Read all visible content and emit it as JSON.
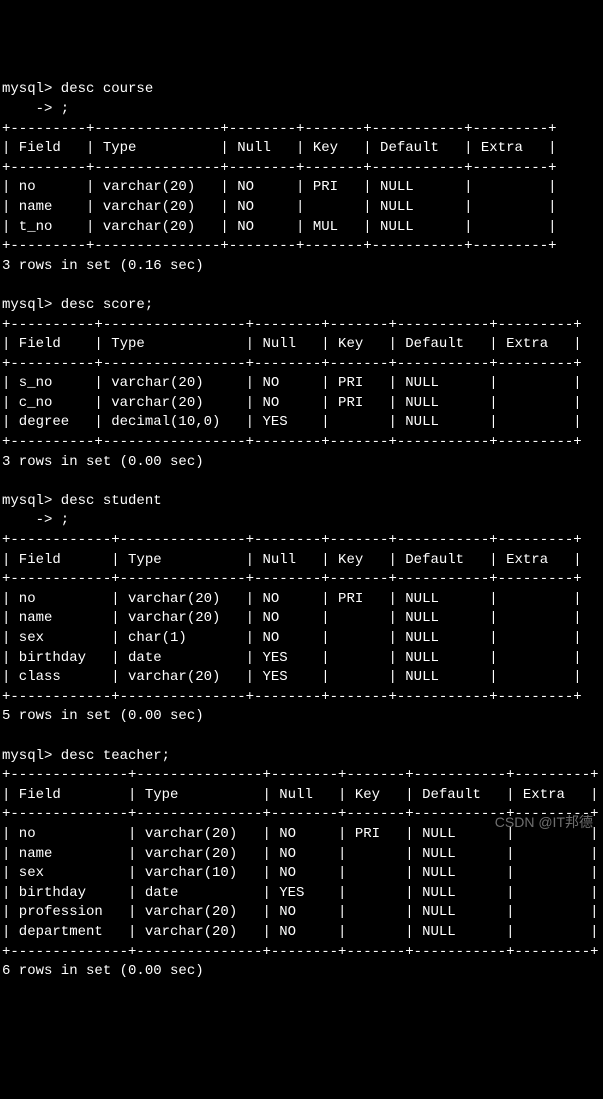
{
  "prompt": "mysql>",
  "cont": "    ->",
  "chart_data": null,
  "sections": [
    {
      "cmd": "desc course",
      "cont": ";",
      "headers": [
        "Field",
        "Type",
        "Null",
        "Key",
        "Default",
        "Extra"
      ],
      "widths": [
        7,
        13,
        6,
        5,
        9,
        7
      ],
      "rows": [
        [
          "no",
          "varchar(20)",
          "NO",
          "PRI",
          "NULL",
          ""
        ],
        [
          "name",
          "varchar(20)",
          "NO",
          "",
          "NULL",
          ""
        ],
        [
          "t_no",
          "varchar(20)",
          "NO",
          "MUL",
          "NULL",
          ""
        ]
      ],
      "footer": "3 rows in set (0.16 sec)"
    },
    {
      "cmd": "desc score;",
      "cont": null,
      "headers": [
        "Field",
        "Type",
        "Null",
        "Key",
        "Default",
        "Extra"
      ],
      "widths": [
        8,
        15,
        6,
        5,
        9,
        7
      ],
      "rows": [
        [
          "s_no",
          "varchar(20)",
          "NO",
          "PRI",
          "NULL",
          ""
        ],
        [
          "c_no",
          "varchar(20)",
          "NO",
          "PRI",
          "NULL",
          ""
        ],
        [
          "degree",
          "decimal(10,0)",
          "YES",
          "",
          "NULL",
          ""
        ]
      ],
      "footer": "3 rows in set (0.00 sec)"
    },
    {
      "cmd": "desc student",
      "cont": ";",
      "headers": [
        "Field",
        "Type",
        "Null",
        "Key",
        "Default",
        "Extra"
      ],
      "widths": [
        10,
        13,
        6,
        5,
        9,
        7
      ],
      "rows": [
        [
          "no",
          "varchar(20)",
          "NO",
          "PRI",
          "NULL",
          ""
        ],
        [
          "name",
          "varchar(20)",
          "NO",
          "",
          "NULL",
          ""
        ],
        [
          "sex",
          "char(1)",
          "NO",
          "",
          "NULL",
          ""
        ],
        [
          "birthday",
          "date",
          "YES",
          "",
          "NULL",
          ""
        ],
        [
          "class",
          "varchar(20)",
          "YES",
          "",
          "NULL",
          ""
        ]
      ],
      "footer": "5 rows in set (0.00 sec)"
    },
    {
      "cmd": "desc teacher;",
      "cont": null,
      "headers": [
        "Field",
        "Type",
        "Null",
        "Key",
        "Default",
        "Extra"
      ],
      "widths": [
        12,
        13,
        6,
        5,
        9,
        7
      ],
      "rows": [
        [
          "no",
          "varchar(20)",
          "NO",
          "PRI",
          "NULL",
          ""
        ],
        [
          "name",
          "varchar(20)",
          "NO",
          "",
          "NULL",
          ""
        ],
        [
          "sex",
          "varchar(10)",
          "NO",
          "",
          "NULL",
          ""
        ],
        [
          "birthday",
          "date",
          "YES",
          "",
          "NULL",
          ""
        ],
        [
          "profession",
          "varchar(20)",
          "NO",
          "",
          "NULL",
          ""
        ],
        [
          "department",
          "varchar(20)",
          "NO",
          "",
          "NULL",
          ""
        ]
      ],
      "footer": "6 rows in set (0.00 sec)"
    }
  ],
  "watermark": "CSDN @IT邦德"
}
